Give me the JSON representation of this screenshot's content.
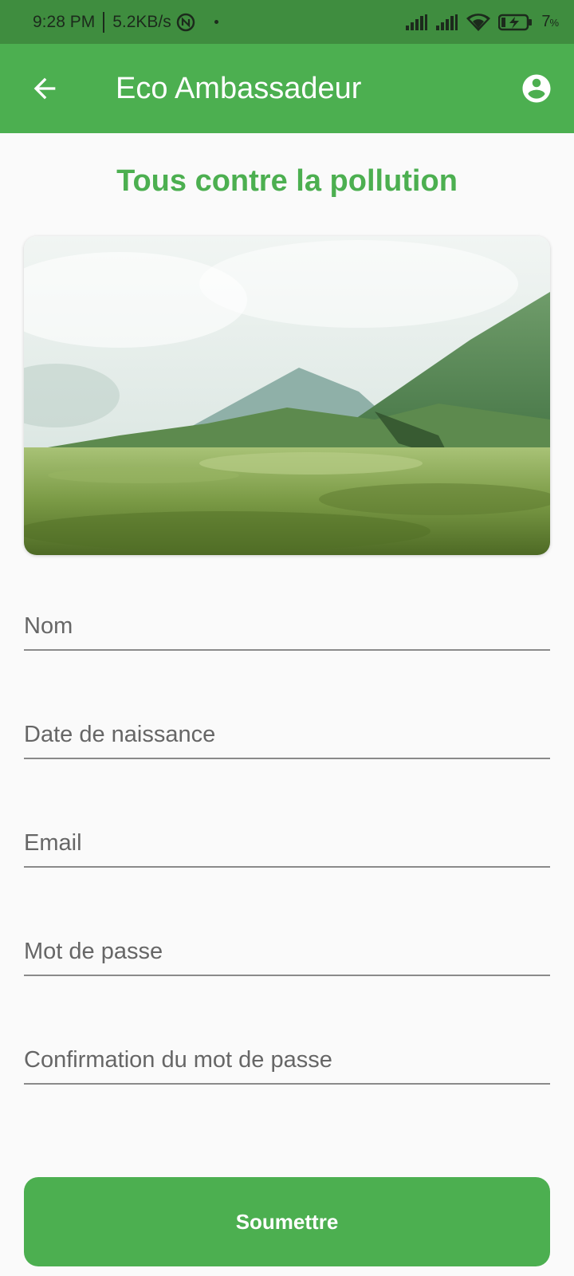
{
  "status_bar": {
    "time": "9:28 PM",
    "speed": "5.2KB/s",
    "battery": "7",
    "battery_unit": "%"
  },
  "app_bar": {
    "title": "Eco Ambassadeur",
    "back_icon": "arrow-back-icon",
    "account_icon": "account-circle-icon"
  },
  "page": {
    "headline": "Tous contre la pollution"
  },
  "form": {
    "fields": [
      {
        "placeholder": "Nom",
        "value": ""
      },
      {
        "placeholder": "Date de naissance",
        "value": ""
      },
      {
        "placeholder": "Email",
        "value": ""
      },
      {
        "placeholder": "Mot de passe",
        "value": ""
      },
      {
        "placeholder": "Confirmation du mot de passe",
        "value": ""
      }
    ],
    "submit_label": "Soumettre"
  },
  "colors": {
    "primary": "#4caf50",
    "status_bar": "#3f8d3f",
    "background": "#fafafa"
  }
}
